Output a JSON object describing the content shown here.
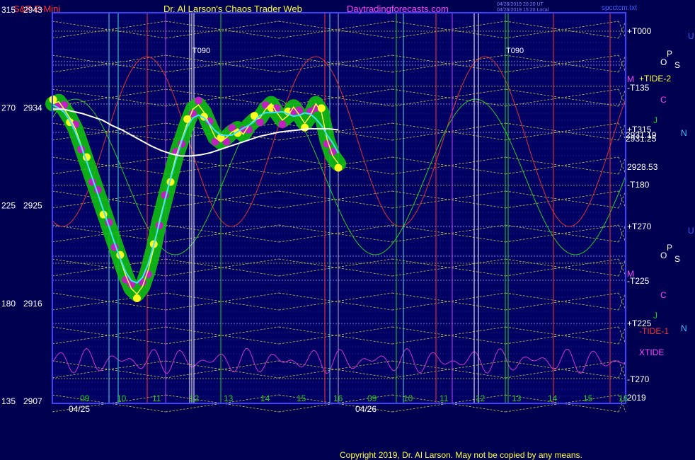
{
  "header": {
    "left_title": "S&P E-Mini",
    "center_title": "Dr. Al Larson's Chaos Trader Web",
    "site": "Daytradingforecasts.com",
    "timestamp_line1": "04/26/2019 20:20 UT",
    "timestamp_line2": "04/26/2019 15:20 Local",
    "file": "spcctcm.txt"
  },
  "footer": {
    "copyright": "Copyright 2019, Dr. Al Larson. May not be copied by any means."
  },
  "chart_data": {
    "type": "line",
    "y_left_labels": [
      {
        "deg": "315",
        "price": "2943"
      },
      {
        "deg": "270",
        "price": "2934"
      },
      {
        "deg": "225",
        "price": "2925"
      },
      {
        "deg": "180",
        "price": "2916"
      },
      {
        "deg": "135",
        "price": "2907"
      }
    ],
    "ylim": [
      2907,
      2943
    ],
    "x_hour_labels": [
      "09",
      "10",
      "11",
      "12",
      "13",
      "14",
      "15",
      "16",
      "09",
      "10",
      "11",
      "12",
      "13",
      "14",
      "15",
      "16"
    ],
    "x_date_labels": [
      "04/25",
      "04/26"
    ],
    "right_labels": [
      "+T000",
      "+TIDE-2",
      "-T135",
      "+T315",
      "2931.19",
      "2931.25",
      "2928.53",
      "-T180",
      "+T270",
      "-T225",
      "+T225",
      "-TIDE-1",
      "XTIDE",
      "-T270",
      "2019"
    ],
    "planet_labels": [
      "U",
      "O",
      "P",
      "S",
      "M",
      "C",
      "J",
      "N"
    ],
    "markers": [
      "T090",
      "T090"
    ],
    "price_series": {
      "name": "S&P E-Mini",
      "values": [
        2934.3,
        2934.5,
        2933.8,
        2933,
        2932,
        2930.5,
        2929,
        2927.5,
        2926,
        2924.5,
        2923,
        2921.5,
        2920,
        2918.5,
        2917.3,
        2916.8,
        2917.5,
        2919,
        2921,
        2923.5,
        2925.5,
        2927.5,
        2929.5,
        2931,
        2932.5,
        2933.8,
        2934.2,
        2933.5,
        2932.3,
        2931.2,
        2930.8,
        2931.2,
        2931.7,
        2932,
        2931.5,
        2932.3,
        2932.8,
        2933,
        2933.8,
        2934.3,
        2933.5,
        2932.8,
        2933.2,
        2934,
        2933.3,
        2932.5,
        2933.2,
        2934.3,
        2933.5,
        2931,
        2929.5,
        2928.8
      ]
    },
    "average_series": {
      "name": "",
      "values": [
        2933.8,
        2933.8,
        2933.6,
        2933.4,
        2933.1,
        2932.8,
        2932.3,
        2931.9,
        2931.4,
        2930.9,
        2930.4,
        2930.0,
        2929.7,
        2929.5,
        2929.5,
        2929.6,
        2929.8,
        2930.1,
        2930.4,
        2930.7,
        2931.0,
        2931.3,
        2931.5,
        2931.7,
        2931.8,
        2931.9,
        2932.0,
        2932.0,
        2932.0,
        2931.9
      ]
    }
  }
}
